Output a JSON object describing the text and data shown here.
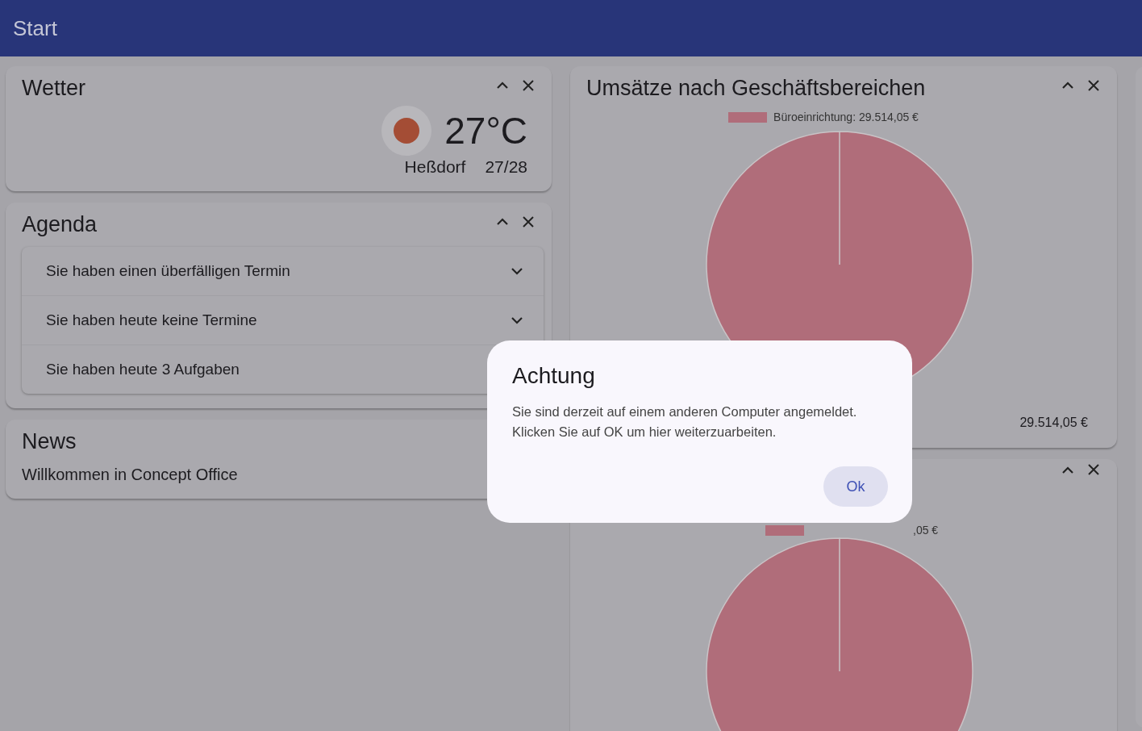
{
  "header": {
    "title": "Start"
  },
  "weather": {
    "title": "Wetter",
    "temperature": "27°C",
    "location": "Heßdorf",
    "range": "27/28"
  },
  "agenda": {
    "title": "Agenda",
    "items": [
      {
        "text": "Sie haben einen überfälligen Termin",
        "expandable": true
      },
      {
        "text": "Sie haben heute keine Termine",
        "expandable": true
      },
      {
        "text": "Sie haben heute 3 Aufgaben"
      }
    ]
  },
  "news": {
    "title": "News",
    "text": "Willkommen in Concept Office"
  },
  "sales": {
    "title": "Umsätze nach Geschäftsbereichen",
    "legend": "Büroeinrichtung: 29.514,05 €",
    "color": "#b06d7a",
    "total": "29.514,05 €"
  },
  "sales_2": {
    "legend_fragment": ",05 €",
    "color": "#b06d7a"
  },
  "dialog": {
    "title": "Achtung",
    "message": "Sie sind derzeit auf einem anderen Computer angemeldet.\nKlicken Sie auf OK um hier weiterzuarbeiten.",
    "button": "Ok"
  }
}
